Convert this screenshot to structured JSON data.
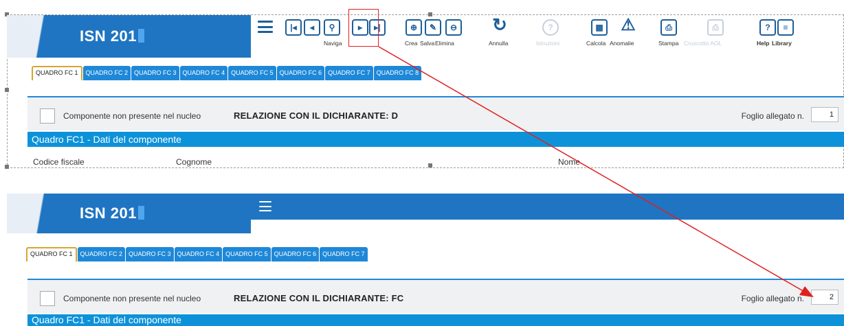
{
  "top": {
    "logo": "ISN 201",
    "toolbar": {
      "navigate_label": "Naviga",
      "crea_label": "Crea",
      "salva_label": "Salva",
      "elimina_label": "Elimina",
      "annulla_label": "Annulla",
      "istruzioni_label": "Istruzioni",
      "calcola_label": "Calcola",
      "anomalie_label": "Anomalie",
      "stampa_label": "Stampa",
      "cruscotto_label": "Cruscotto AOL",
      "help_label": "Help",
      "library_label": "Library"
    },
    "tabs": [
      "QUADRO FC 1",
      "QUADRO FC 2",
      "QUADRO FC 3",
      "QUADRO FC 4",
      "QUADRO FC 5",
      "QUADRO FC 6",
      "QUADRO FC 7",
      "QUADRO FC 8"
    ],
    "checkbox_label": "Componente non presente nel nucleo",
    "relation": "RELAZIONE CON IL DICHIARANTE: D",
    "foglio_label": "Foglio allegato n.",
    "foglio_value": "1",
    "section_title": "Quadro FC1 - Dati del componente",
    "fields": [
      "Codice fiscale",
      "Cognome",
      "Nome"
    ]
  },
  "bottom": {
    "logo": "ISN 201",
    "tabs": [
      "QUADRO FC 1",
      "QUADRO FC 2",
      "QUADRO FC 3",
      "QUADRO FC 4",
      "QUADRO FC 5",
      "QUADRO FC 6",
      "QUADRO FC 7"
    ],
    "checkbox_label": "Componente non presente nel nucleo",
    "relation": "RELAZIONE CON IL DICHIARANTE: FC",
    "foglio_label": "Foglio allegato n.",
    "foglio_value": "2",
    "section_title": "Quadro FC1 - Dati del componente"
  },
  "colors": {
    "brand_blue": "#1f75c2",
    "tab_blue": "#1e88d8",
    "section_blue": "#0d92d9",
    "active_tab_border": "#d8a531",
    "annotation_red": "#e02020"
  }
}
